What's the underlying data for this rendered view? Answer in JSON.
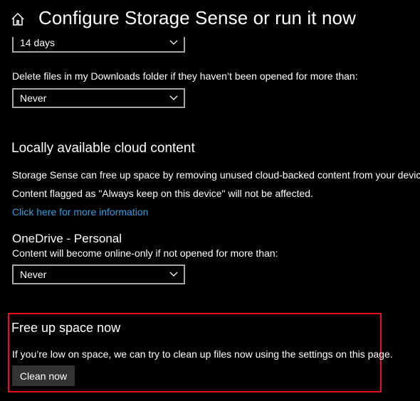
{
  "header": {
    "title": "Configure Storage Sense or run it now"
  },
  "temp_files": {
    "recycle_bin_value": "14 days"
  },
  "downloads": {
    "label": "Delete files in my Downloads folder if they haven’t been opened for more than:",
    "value": "Never"
  },
  "cloud": {
    "title": "Locally available cloud content",
    "description_1": "Storage Sense can free up space by removing unused cloud-backed content from your device.",
    "description_2": "Content flagged as \"Always keep on this device\" will not be affected.",
    "more_info_link": "Click here for more information",
    "onedrive": {
      "title": "OneDrive - Personal",
      "label": "Content will become online-only if not opened for more than:",
      "value": "Never"
    }
  },
  "free_up": {
    "title": "Free up space now",
    "description": "If you’re low on space, we can try to clean up files now using the settings on this page.",
    "button_label": "Clean now"
  },
  "colors": {
    "background": "#000000",
    "link": "#3a9bdc",
    "highlight_border": "#e81123",
    "button_bg": "#333333"
  }
}
